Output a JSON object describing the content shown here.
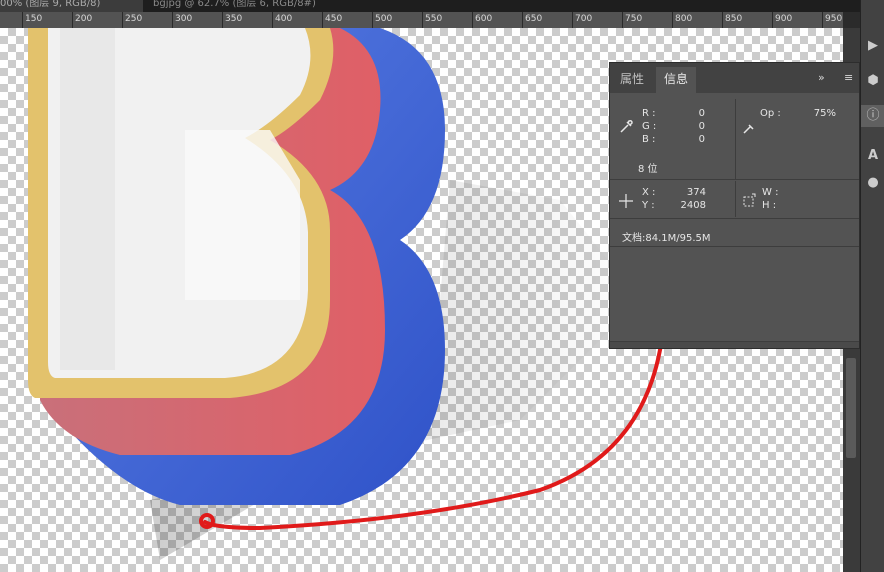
{
  "doc_tabs": [
    {
      "label": "00% (图层 9, RGB/8)"
    },
    {
      "label": "bgjpg @ 62.7% (图层 6, RGB/8#)"
    }
  ],
  "ruler": {
    "labels": [
      "150",
      "200",
      "250",
      "300",
      "350",
      "400",
      "450",
      "500",
      "550",
      "600",
      "650",
      "700",
      "750",
      "800",
      "850",
      "900",
      "950"
    ]
  },
  "panel": {
    "tabs": {
      "properties": "属性",
      "info": "信息"
    },
    "expand": "»",
    "menu": "≡",
    "r_label": "R :",
    "r_value": "0",
    "g_label": "G :",
    "g_value": "0",
    "b_label": "B :",
    "b_value": "0",
    "bits": "8 位",
    "op_label": "Op :",
    "op_value": "75%",
    "x_label": "X :",
    "x_value": "374",
    "y_label": "Y :",
    "y_value": "2408",
    "w_label": "W :",
    "h_label": "H :",
    "doc_size": "文档:84.1M/95.5M"
  },
  "colors": {
    "annotation": "#e01a1a",
    "letter_blue": "#3d63d6",
    "letter_red": "#d9646c",
    "letter_gold": "#e3c26c"
  },
  "icons": [
    "eyedropper-icon",
    "eyedropper-opacity-icon",
    "crosshair-icon",
    "selection-size-icon",
    "play-icon",
    "info-icon",
    "cube-icon",
    "brush-icon"
  ]
}
